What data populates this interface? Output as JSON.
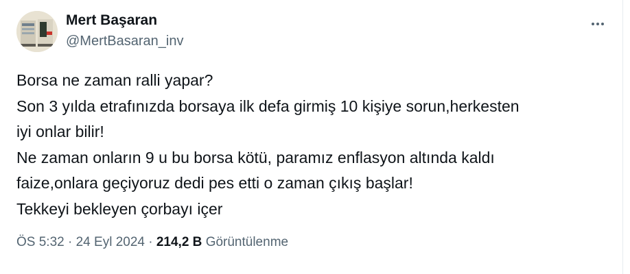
{
  "author": {
    "name": "Mert Başaran",
    "handle": "@MertBasaran_inv"
  },
  "tweet": {
    "lines": [
      "Borsa ne zaman ralli yapar?",
      "Son 3 yılda etrafınızda borsaya ilk defa girmiş 10 kişiye sorun,herkesten",
      "iyi onlar bilir!",
      "Ne zaman onların 9 u bu borsa kötü, paramız enflasyon altında kaldı",
      "faize,onlara geçiyoruz dedi pes etti o zaman çıkış başlar!",
      "Tekkeyi bekleyen çorbayı içer"
    ]
  },
  "meta": {
    "time": "ÖS 5:32",
    "separator": "·",
    "date": "24 Eyl 2024",
    "views_count": "214,2 B",
    "views_label": "Görüntülenme"
  },
  "icons": {
    "more": "more-horizontal-icon"
  },
  "colors": {
    "text": "#0f1419",
    "secondary": "#536471"
  }
}
